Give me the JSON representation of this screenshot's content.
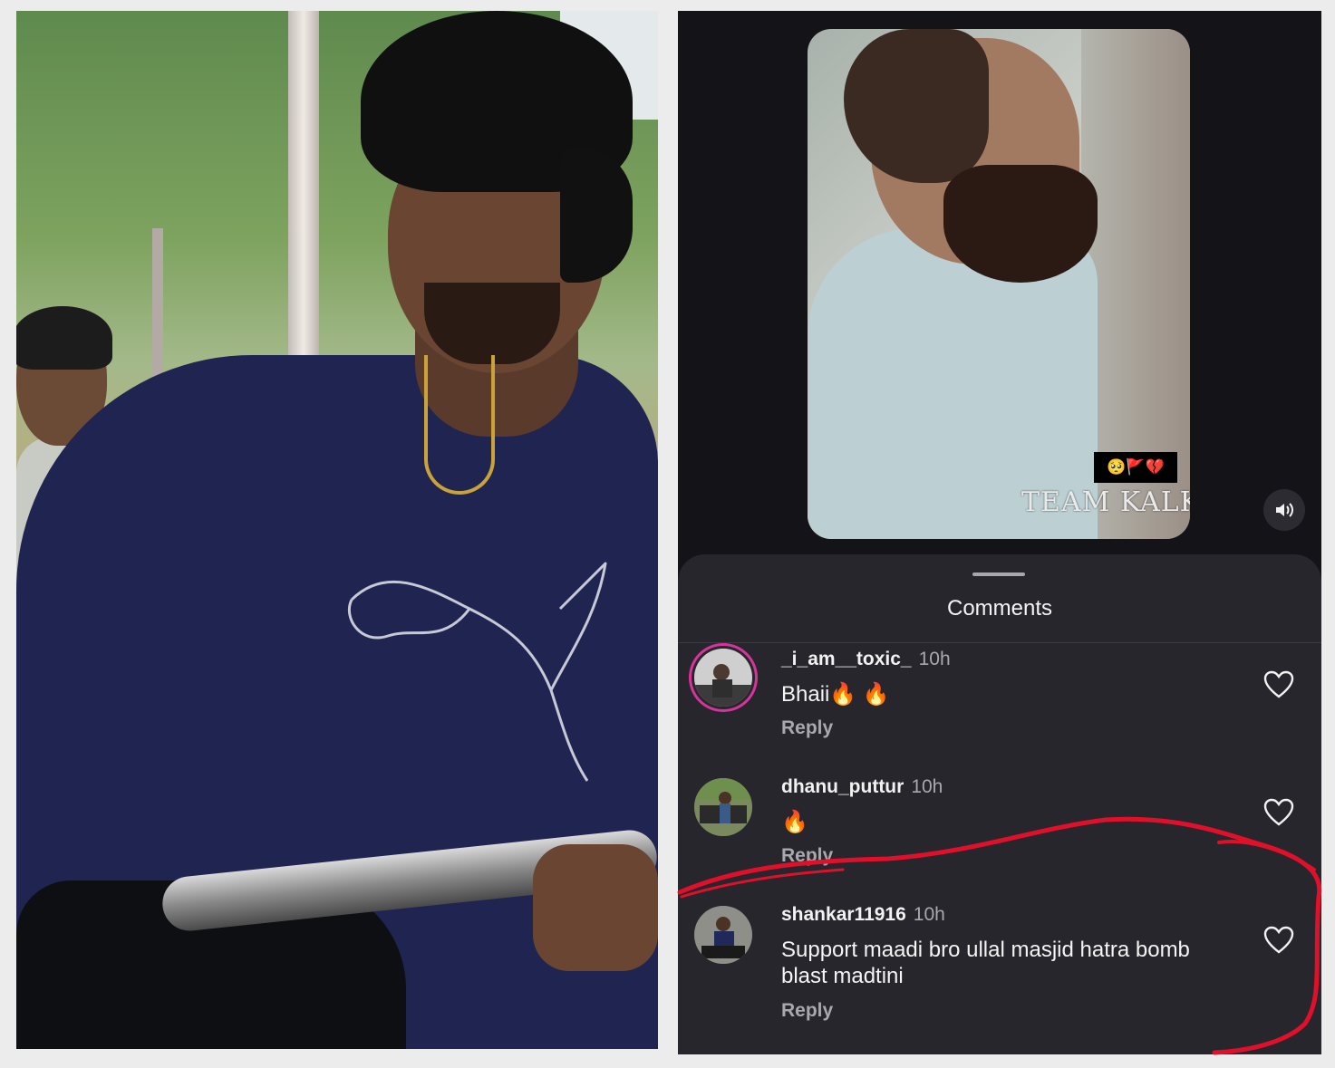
{
  "video": {
    "emoji_tag": "🥺🚩💔",
    "watermark": "TEAM KALK",
    "sound_icon": "volume-icon"
  },
  "sheet": {
    "title": "Comments"
  },
  "comments": [
    {
      "username": "_i_am__toxic_",
      "time": "10h",
      "text": "Bhaii🔥 🔥",
      "reply": "Reply"
    },
    {
      "username": "dhanu_puttur",
      "time": "10h",
      "text": "🔥",
      "reply": "Reply"
    },
    {
      "username": "shankar11916",
      "time": "10h",
      "text": "Support maadi bro ullal masjid hatra bomb blast madtini",
      "reply": "Reply"
    }
  ],
  "colors": {
    "panel_bg": "#131318",
    "sheet_bg": "#26262c",
    "annotation_red": "#e0102a",
    "story_ring": "#d6349b"
  }
}
